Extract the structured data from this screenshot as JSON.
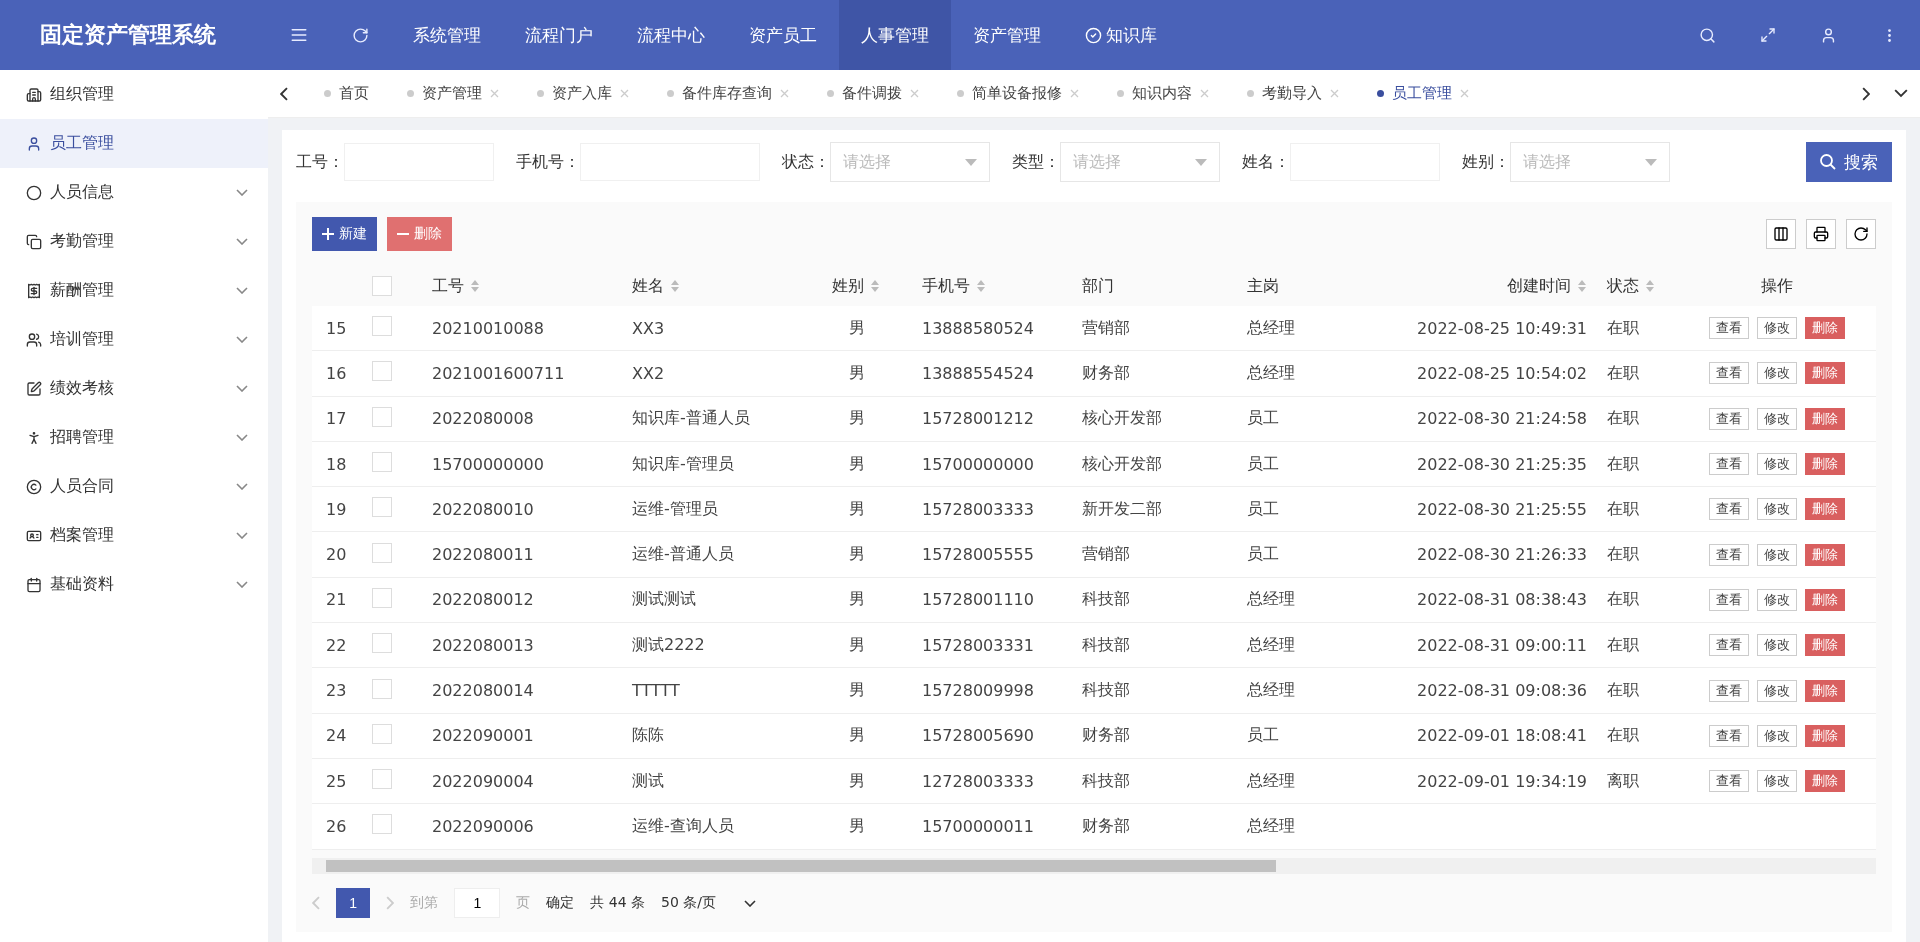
{
  "app": {
    "title": "固定资产管理系统"
  },
  "top_nav": [
    {
      "label": "系统管理",
      "selected": false,
      "kind": "plain"
    },
    {
      "label": "流程门户",
      "selected": false,
      "kind": "plain"
    },
    {
      "label": "流程中心",
      "selected": false,
      "kind": "plain"
    },
    {
      "label": "资产员工",
      "selected": false,
      "kind": "plain"
    },
    {
      "label": "人事管理",
      "selected": true,
      "kind": "plain"
    },
    {
      "label": "资产管理",
      "selected": false,
      "kind": "plain"
    },
    {
      "label": "知识库",
      "selected": false,
      "kind": "check"
    }
  ],
  "sidebar": {
    "items": [
      {
        "label": "组织管理",
        "kind": "link",
        "selected": false
      },
      {
        "label": "员工管理",
        "kind": "link",
        "selected": true
      },
      {
        "label": "人员信息",
        "kind": "group",
        "selected": false
      },
      {
        "label": "考勤管理",
        "kind": "group",
        "selected": false
      },
      {
        "label": "薪酬管理",
        "kind": "group",
        "selected": false
      },
      {
        "label": "培训管理",
        "kind": "group",
        "selected": false
      },
      {
        "label": "绩效考核",
        "kind": "group",
        "selected": false
      },
      {
        "label": "招聘管理",
        "kind": "group",
        "selected": false
      },
      {
        "label": "人员合同",
        "kind": "group",
        "selected": false
      },
      {
        "label": "档案管理",
        "kind": "group",
        "selected": false
      },
      {
        "label": "基础资料",
        "kind": "group",
        "selected": false
      }
    ]
  },
  "tabs": [
    {
      "label": "首页",
      "closable": false,
      "selected": false
    },
    {
      "label": "资产管理",
      "closable": true,
      "selected": false
    },
    {
      "label": "资产入库",
      "closable": true,
      "selected": false
    },
    {
      "label": "备件库存查询",
      "closable": true,
      "selected": false
    },
    {
      "label": "备件调拨",
      "closable": true,
      "selected": false
    },
    {
      "label": "简单设备报修",
      "closable": true,
      "selected": false
    },
    {
      "label": "知识内容",
      "closable": true,
      "selected": false
    },
    {
      "label": "考勤导入",
      "closable": true,
      "selected": false
    },
    {
      "label": "员工管理",
      "closable": true,
      "selected": true
    }
  ],
  "filters": [
    {
      "label": "工号：",
      "kind": "text"
    },
    {
      "label": "手机号：",
      "kind": "text"
    },
    {
      "label": "状态：",
      "kind": "select",
      "placeholder": "请选择"
    },
    {
      "label": "类型：",
      "kind": "select",
      "placeholder": "请选择"
    },
    {
      "label": "姓名：",
      "kind": "text"
    },
    {
      "label": "姓别：",
      "kind": "select",
      "placeholder": "请选择"
    }
  ],
  "search_button": "搜索",
  "actions": [
    {
      "label": "新建",
      "kind": "primary"
    },
    {
      "label": "删除",
      "kind": "danger"
    }
  ],
  "table": {
    "all_checked": false,
    "columns": [
      {
        "label": "工号",
        "sortable": true
      },
      {
        "label": "姓名",
        "sortable": true
      },
      {
        "label": "姓别",
        "sortable": true
      },
      {
        "label": "手机号",
        "sortable": true
      },
      {
        "label": "部门",
        "sortable": false
      },
      {
        "label": "主岗",
        "sortable": false
      },
      {
        "label": "创建时间",
        "sortable": true
      },
      {
        "label": "状态",
        "sortable": true
      },
      {
        "label": "操作",
        "sortable": false
      }
    ],
    "rows": [
      {
        "index": "15",
        "checked": false,
        "cells": [
          "20210010088",
          "XX3",
          "男",
          "13888580524",
          "营销部",
          "总经理",
          "2022-08-25 10:49:31",
          "在职"
        ],
        "buttons": [
          "查看",
          "修改",
          "删除"
        ]
      },
      {
        "index": "16",
        "checked": false,
        "cells": [
          "2021001600711",
          "XX2",
          "男",
          "13888554524",
          "财务部",
          "总经理",
          "2022-08-25 10:54:02",
          "在职"
        ],
        "buttons": [
          "查看",
          "修改",
          "删除"
        ]
      },
      {
        "index": "17",
        "checked": false,
        "cells": [
          "2022080008",
          "知识库-普通人员",
          "男",
          "15728001212",
          "核心开发部",
          "员工",
          "2022-08-30 21:24:58",
          "在职"
        ],
        "buttons": [
          "查看",
          "修改",
          "删除"
        ]
      },
      {
        "index": "18",
        "checked": false,
        "cells": [
          "15700000000",
          "知识库-管理员",
          "男",
          "15700000000",
          "核心开发部",
          "员工",
          "2022-08-30 21:25:35",
          "在职"
        ],
        "buttons": [
          "查看",
          "修改",
          "删除"
        ]
      },
      {
        "index": "19",
        "checked": false,
        "cells": [
          "2022080010",
          "运维-管理员",
          "男",
          "15728003333",
          "新开发二部",
          "员工",
          "2022-08-30 21:25:55",
          "在职"
        ],
        "buttons": [
          "查看",
          "修改",
          "删除"
        ]
      },
      {
        "index": "20",
        "checked": false,
        "cells": [
          "2022080011",
          "运维-普通人员",
          "男",
          "15728005555",
          "营销部",
          "员工",
          "2022-08-30 21:26:33",
          "在职"
        ],
        "buttons": [
          "查看",
          "修改",
          "删除"
        ]
      },
      {
        "index": "21",
        "checked": false,
        "cells": [
          "2022080012",
          "测试测试",
          "男",
          "15728001110",
          "科技部",
          "总经理",
          "2022-08-31 08:38:43",
          "在职"
        ],
        "buttons": [
          "查看",
          "修改",
          "删除"
        ]
      },
      {
        "index": "22",
        "checked": false,
        "cells": [
          "2022080013",
          "测试2222",
          "男",
          "15728003331",
          "科技部",
          "总经理",
          "2022-08-31 09:00:11",
          "在职"
        ],
        "buttons": [
          "查看",
          "修改",
          "删除"
        ]
      },
      {
        "index": "23",
        "checked": false,
        "cells": [
          "2022080014",
          "TTTTT",
          "男",
          "15728009998",
          "科技部",
          "总经理",
          "2022-08-31 09:08:36",
          "在职"
        ],
        "buttons": [
          "查看",
          "修改",
          "删除"
        ]
      },
      {
        "index": "24",
        "checked": false,
        "cells": [
          "2022090001",
          "陈陈",
          "男",
          "15728005690",
          "财务部",
          "员工",
          "2022-09-01 18:08:41",
          "在职"
        ],
        "buttons": [
          "查看",
          "修改",
          "删除"
        ]
      },
      {
        "index": "25",
        "checked": false,
        "cells": [
          "2022090004",
          "测试",
          "男",
          "12728003333",
          "科技部",
          "总经理",
          "2022-09-01 19:34:19",
          "离职"
        ],
        "buttons": [
          "查看",
          "修改",
          "删除"
        ]
      },
      {
        "index": "26",
        "checked": false,
        "cells": [
          "2022090006",
          "运维-查询人员",
          "男",
          "15700000011",
          "财务部",
          "总经理"
        ]
      }
    ]
  },
  "pagination": {
    "pages": [
      {
        "label": "1",
        "selected": true
      }
    ],
    "goto_label": "到第",
    "goto_value": "1",
    "page_unit": "页",
    "confirm": "确定",
    "total": "共 44 条",
    "page_size": "50 条/页"
  }
}
